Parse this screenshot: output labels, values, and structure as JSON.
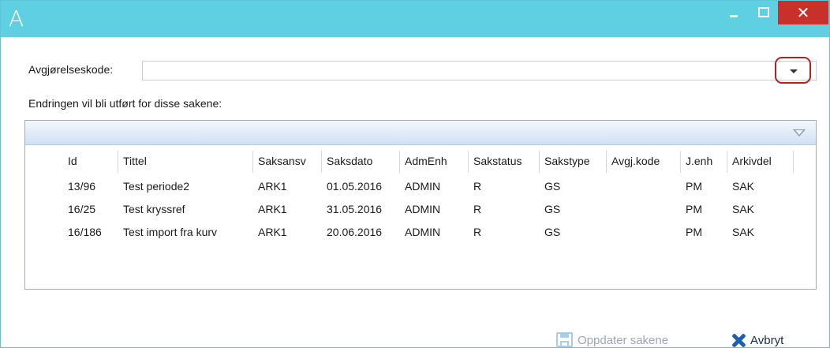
{
  "window": {
    "logo_text": "A",
    "close_glyph": "✕",
    "titlebar_color": "#5fd0e2",
    "close_color": "#c7312a"
  },
  "form": {
    "decision_code_label": "Avgjørelseskode:",
    "decision_code_value": "",
    "cases_label": "Endringen vil bli utført for disse sakene:"
  },
  "table": {
    "columns": [
      "Id",
      "Tittel",
      "Saksansv",
      "Saksdato",
      "AdmEnh",
      "Sakstatus",
      "Sakstype",
      "Avgj.kode",
      "J.enh",
      "Arkivdel"
    ],
    "rows": [
      [
        "13/96",
        "Test periode2",
        "ARK1",
        "01.05.2016",
        "ADMIN",
        "R",
        "GS",
        "",
        "PM",
        "SAK"
      ],
      [
        "16/25",
        "Test kryssref",
        "ARK1",
        "31.05.2016",
        "ADMIN",
        "R",
        "GS",
        "",
        "PM",
        "SAK"
      ],
      [
        "16/186",
        "Test import fra kurv",
        "ARK1",
        "20.06.2016",
        "ADMIN",
        "R",
        "GS",
        "",
        "PM",
        "SAK"
      ]
    ]
  },
  "actions": {
    "update_label": "Oppdater sakene",
    "update_icon": "save-icon",
    "update_enabled": false,
    "cancel_label": "Avbryt",
    "cancel_icon": "close-x-icon",
    "cancel_color": "#1f5fb2"
  }
}
